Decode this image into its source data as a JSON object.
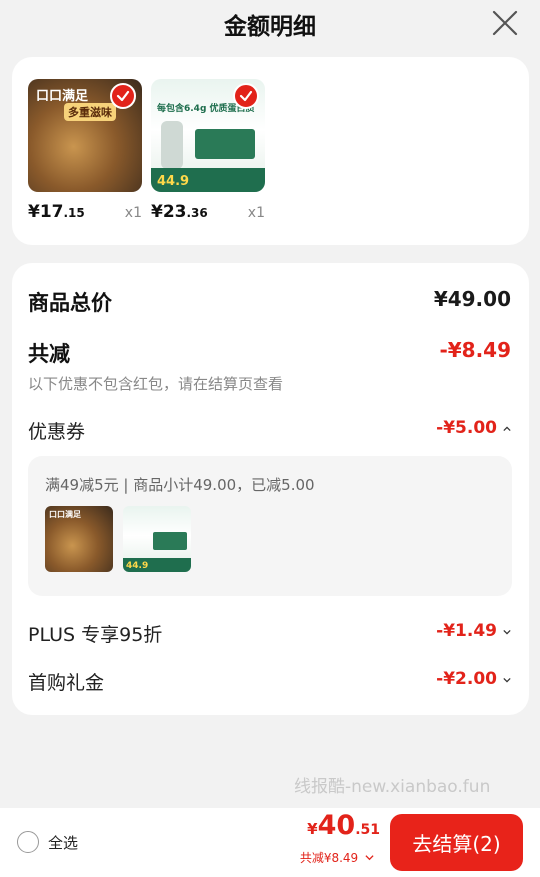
{
  "header": {
    "title": "金额明细"
  },
  "products": [
    {
      "price_int": "¥17",
      "price_dec": ".15",
      "qty": "x1",
      "thumb_text": "口口满足",
      "thumb_sub": "多重滋味"
    },
    {
      "price_int": "¥23",
      "price_dec": ".36",
      "qty": "x1",
      "thumb_text": "每包含6.4g 优质蛋白质",
      "thumb_sub": "44.9"
    }
  ],
  "summary": {
    "total_label": "商品总价",
    "total_value": "¥49.00",
    "discount_label": "共减",
    "discount_value": "-¥8.49",
    "discount_note": "以下优惠不包含红包，请在结算页查看"
  },
  "coupon": {
    "label": "优惠券",
    "value": "-¥5.00",
    "detail": "满49减5元 | 商品小计49.00，已减5.00"
  },
  "plus": {
    "label": "PLUS 专享95折",
    "value": "-¥1.49"
  },
  "firstbuy": {
    "label": "首购礼金",
    "value": "-¥2.00"
  },
  "watermark": "线报酷-new.xianbao.fun",
  "bottom": {
    "select_all": "全选",
    "yen": "¥",
    "total_int": "40",
    "total_dec": ".51",
    "saved": "共减¥8.49",
    "checkout": "去结算(2)"
  },
  "colors": {
    "accent": "#e2231a",
    "background": "#f2f2f2"
  }
}
